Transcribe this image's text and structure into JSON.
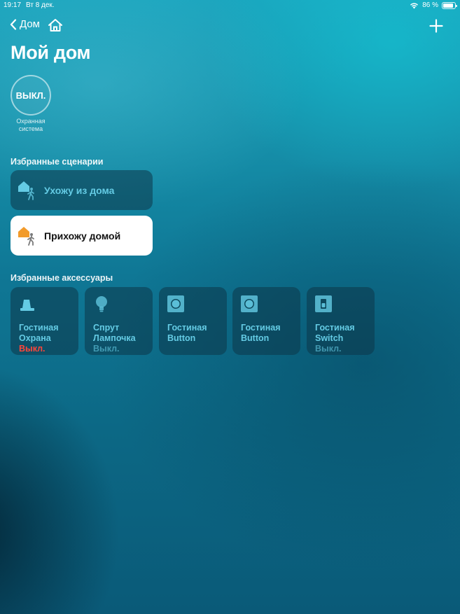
{
  "status_bar": {
    "time": "19:17",
    "date": "Вт 8 дек.",
    "battery": "86 %",
    "battery_level": 0.86
  },
  "nav": {
    "back_label": "Дом",
    "home_icon": "house-icon",
    "add_icon": "plus-icon"
  },
  "title": "Мой дом",
  "security": {
    "state": "ВЫКЛ.",
    "caption_line1": "Охранная",
    "caption_line2": "система"
  },
  "favorite_scenes": {
    "title": "Избранные сценарии",
    "items": [
      {
        "label": "Ухожу из дома",
        "active": false
      },
      {
        "label": "Прихожу домой",
        "active": true
      }
    ]
  },
  "favorite_accessories": {
    "title": "Избранные аксессуары",
    "items": [
      {
        "room": "Гостиная",
        "name": "Охрана",
        "state": "Выкл.",
        "icon": "siren-icon"
      },
      {
        "room": "Спрут",
        "name": "Лампочка",
        "state": "Выкл.",
        "icon": "lightbulb-icon"
      },
      {
        "room": "Гостиная",
        "name": "Button",
        "state": "",
        "icon": "button-icon"
      },
      {
        "room": "Гостиная",
        "name": "Button",
        "state": "",
        "icon": "button-icon"
      },
      {
        "room": "Гостиная",
        "name": "Switch",
        "state": "Выкл.",
        "icon": "switch-icon"
      }
    ]
  },
  "colors": {
    "accent": "#64cbe4",
    "alert": "#ff453a",
    "scene_icon_orange": "#f29b2b"
  }
}
